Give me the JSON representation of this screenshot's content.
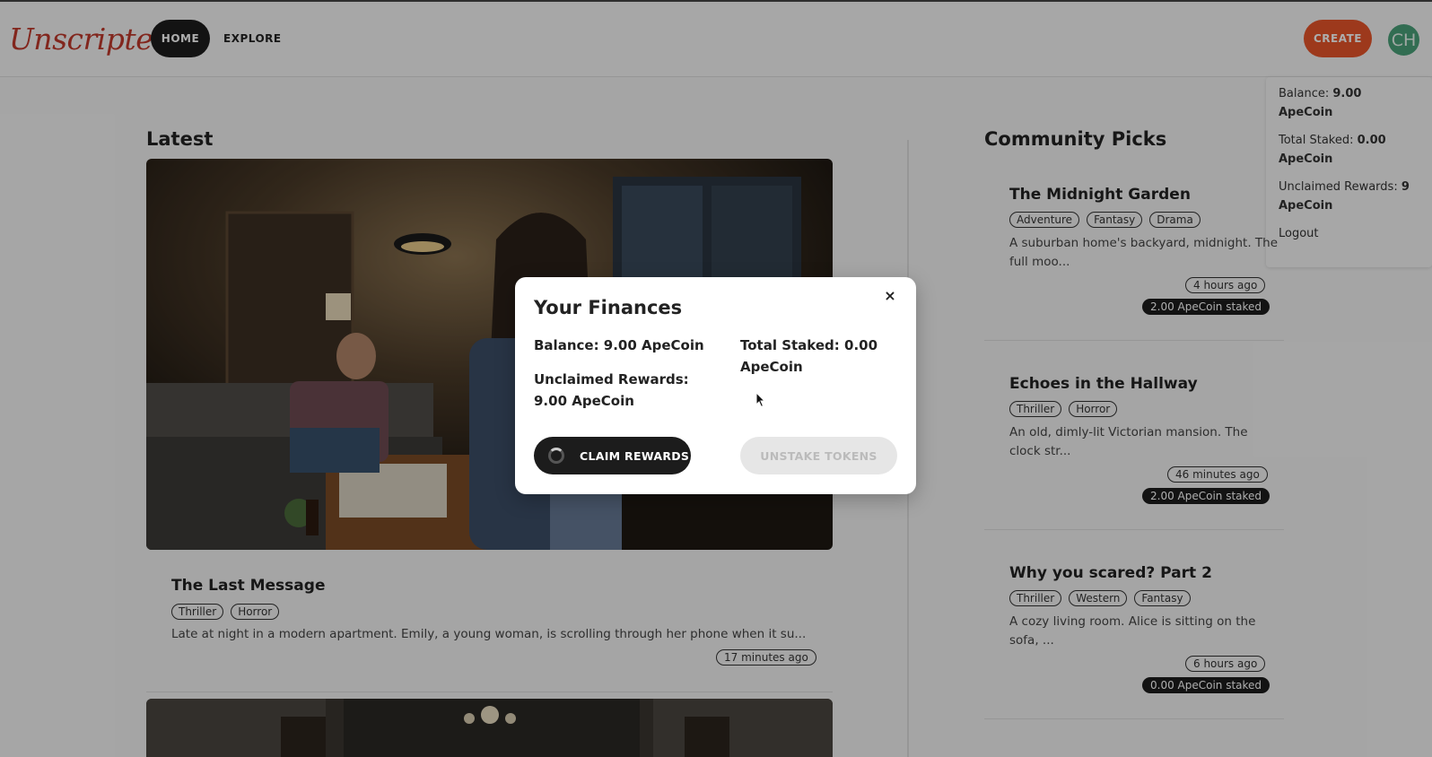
{
  "header": {
    "logo": "Unscripted",
    "nav": {
      "home": "HOME",
      "explore": "EXPLORE"
    },
    "create_label": "CREATE",
    "avatar_initials": "CH"
  },
  "dropdown": {
    "balance_label": "Balance: ",
    "balance_value": "9.00 ApeCoin",
    "staked_label": "Total Staked: ",
    "staked_value": "0.00 ApeCoin",
    "rewards_label": "Unclaimed Rewards: ",
    "rewards_value": "9 ApeCoin",
    "logout": "Logout"
  },
  "latest": {
    "heading": "Latest",
    "story": {
      "title": "The Last Message",
      "tags": [
        "Thriller",
        "Horror"
      ],
      "excerpt": "Late at night in a modern apartment. Emily, a young woman, is scrolling through her phone when it su...",
      "time": "17 minutes ago"
    }
  },
  "community": {
    "heading": "Community Picks",
    "picks": [
      {
        "title": "The Midnight Garden",
        "tags": [
          "Adventure",
          "Fantasy",
          "Drama"
        ],
        "excerpt_l1": "A suburban home's backyard, midnight. The",
        "excerpt_l2": "full moo...",
        "time": "4 hours ago",
        "staked": "2.00 ApeCoin staked"
      },
      {
        "title": "Echoes in the Hallway",
        "tags": [
          "Thriller",
          "Horror"
        ],
        "excerpt_l1": "An old, dimly-lit Victorian mansion. The",
        "excerpt_l2": "clock str...",
        "time": "46 minutes ago",
        "staked": "2.00 ApeCoin staked"
      },
      {
        "title": "Why you scared? Part 2",
        "tags": [
          "Thriller",
          "Western",
          "Fantasy"
        ],
        "excerpt_l1": "A cozy living room. Alice is sitting on the",
        "excerpt_l2": "sofa, ...",
        "time": "6 hours ago",
        "staked": "0.00 ApeCoin staked"
      }
    ]
  },
  "modal": {
    "title": "Your Finances",
    "close": "×",
    "balance": "Balance: 9.00 ApeCoin",
    "staked_l1": "Total Staked: 0.00",
    "staked_l2": "ApeCoin",
    "rewards_l1": "Unclaimed Rewards:",
    "rewards_l2": "9.00 ApeCoin",
    "claim_label": "CLAIM REWARDS",
    "unstake_label": "UNSTAKE TOKENS"
  },
  "colors": {
    "accent": "#e8542a",
    "logo": "#c0392b",
    "avatar": "#4aa17a",
    "dark": "#1c1c1c"
  }
}
